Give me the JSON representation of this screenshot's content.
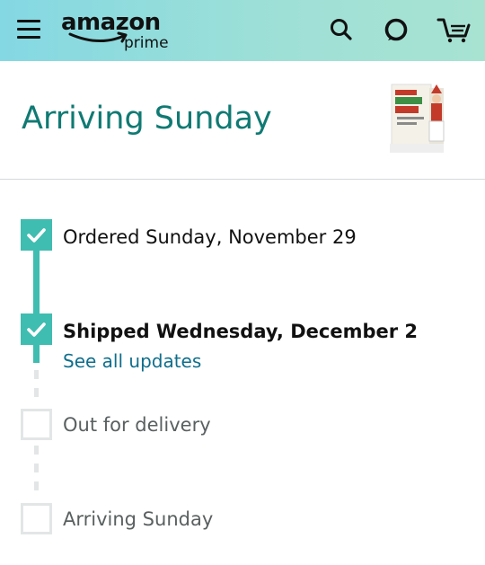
{
  "app": {
    "brand": "amazon",
    "sub_brand": "prime"
  },
  "header": {
    "title": "Arriving Sunday"
  },
  "product": {
    "image_icon": "elf-on-the-shelf-box-image"
  },
  "timeline": {
    "steps": [
      {
        "label": "Ordered Sunday, November 29",
        "status": "complete"
      },
      {
        "label": "Shipped Wednesday, December 2",
        "status": "complete",
        "link": "See all updates"
      },
      {
        "label": "Out for delivery",
        "status": "pending"
      },
      {
        "label": "Arriving Sunday",
        "status": "pending"
      }
    ]
  },
  "colors": {
    "accent": "#3fbdb0",
    "title": "#0f7a73",
    "link": "#0f6e8c",
    "pending": "#e3e6e6"
  }
}
